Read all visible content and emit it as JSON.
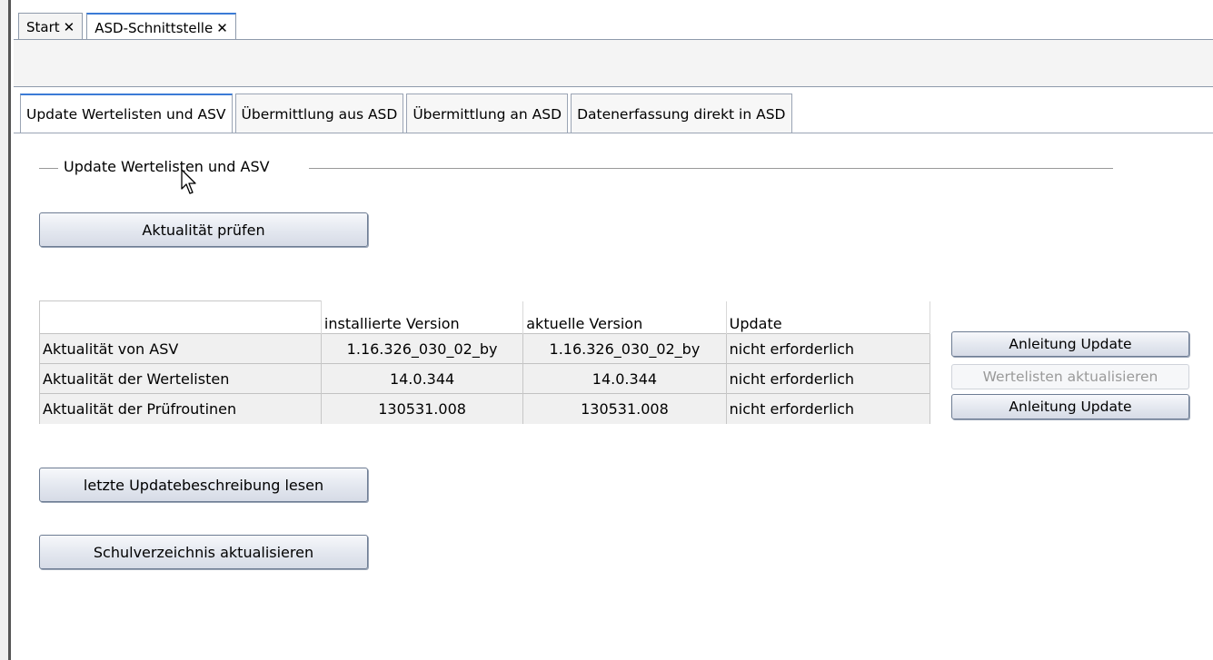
{
  "outer_tabs": [
    {
      "label": "Start",
      "close": "✕"
    },
    {
      "label": "ASD-Schnittstelle",
      "close": "✕"
    }
  ],
  "inner_tabs": [
    {
      "label": "Update Wertelisten und ASV"
    },
    {
      "label": "Übermittlung aus ASD"
    },
    {
      "label": "Übermittlung an ASD"
    },
    {
      "label": "Datenerfassung direkt in ASD"
    }
  ],
  "group": {
    "title": "Update Wertelisten und ASV"
  },
  "buttons": {
    "check": "Aktualität prüfen",
    "read_description": "letzte Updatebeschreibung lesen",
    "update_school_dir": "Schulverzeichnis aktualisieren",
    "guide_1": "Anleitung Update",
    "update_lists": "Wertelisten aktualisieren",
    "guide_2": "Anleitung Update"
  },
  "table": {
    "headers": [
      "",
      "installierte Version",
      "aktuelle Version",
      "Update"
    ],
    "rows": [
      [
        "Aktualität von ASV",
        "1.16.326_030_02_by",
        "1.16.326_030_02_by",
        "nicht erforderlich"
      ],
      [
        "Aktualität der Wertelisten",
        "14.0.344",
        "14.0.344",
        "nicht erforderlich"
      ],
      [
        "Aktualität der Prüfroutinen",
        "130531.008",
        "130531.008",
        "nicht erforderlich"
      ]
    ]
  }
}
